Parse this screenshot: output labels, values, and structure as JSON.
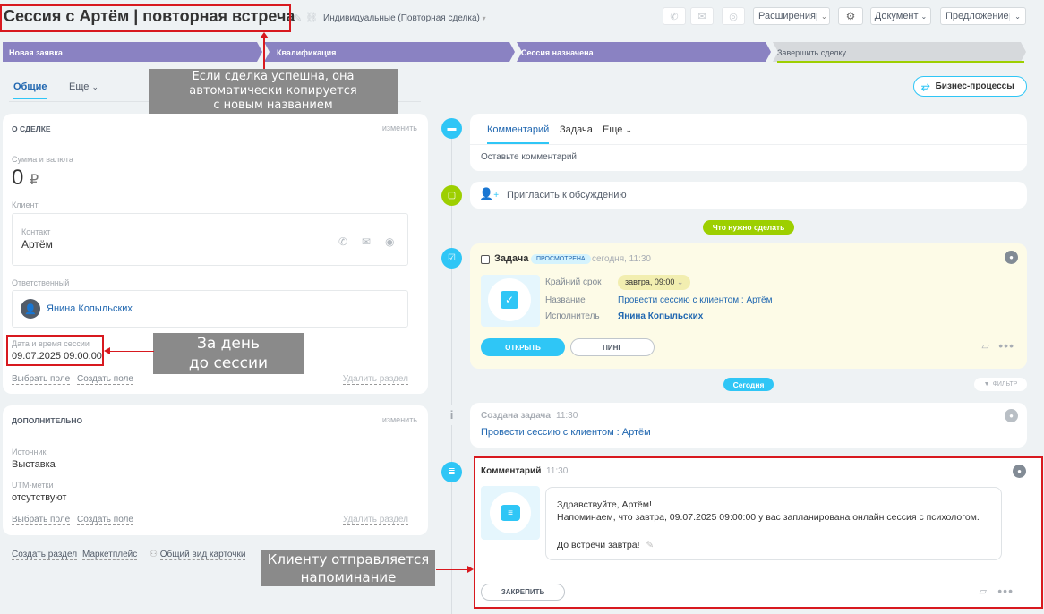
{
  "header": {
    "title": "Сессия с Артём | повторная встреча",
    "pipeline": "Индивидуальные (Повторная сделка)",
    "extensions_label": "Расширения",
    "document_label": "Документ",
    "offer_label": "Предложение"
  },
  "stages": [
    "Новая заявка",
    "Квалификация",
    "Сессия назначена",
    "Завершить сделку"
  ],
  "tabs": {
    "general": "Общие",
    "more": "Еще"
  },
  "bp_button": "Бизнес-процессы",
  "about": {
    "heading": "О СДЕЛКЕ",
    "edit": "изменить",
    "amount_label": "Сумма и валюта",
    "amount": "0",
    "currency": "₽",
    "client_label": "Клиент",
    "contact_label": "Контакт",
    "contact_name": "Артём",
    "responsible_label": "Ответственный",
    "responsible_name": "Янина Копыльских",
    "session_label": "Дата и время сессии",
    "session_value": "09.07.2025 09:00:00",
    "select_field": "Выбрать поле",
    "create_field": "Создать поле",
    "delete_section": "Удалить раздел"
  },
  "extra": {
    "heading": "ДОПОЛНИТЕЛЬНО",
    "edit": "изменить",
    "source_label": "Источник",
    "source_value": "Выставка",
    "utm_label": "UTM-метки",
    "utm_value": "отсутствуют",
    "select_field": "Выбрать поле",
    "create_field": "Создать поле",
    "delete_section": "Удалить раздел"
  },
  "bottom_links": {
    "create_section": "Создать раздел",
    "marketplace": "Маркетплейс",
    "card_view": "Общий вид карточки"
  },
  "composer": {
    "tab_comment": "Комментарий",
    "tab_task": "Задача",
    "tab_more": "Еще",
    "placeholder": "Оставьте комментарий"
  },
  "invite": "Пригласить к обсуждению",
  "todo_badge": "Что нужно сделать",
  "task": {
    "title": "Задача",
    "badge": "ПРОСМОТРЕНА",
    "time": "сегодня, 11:30",
    "deadline_label": "Крайний срок",
    "deadline_value": "завтра, 09:00",
    "name_label": "Название",
    "name_value": "Провести сессию с клиентом : Артём",
    "assignee_label": "Исполнитель",
    "assignee_value": "Янина Копыльских",
    "open": "ОТКРЫТЬ",
    "ping": "ПИНГ"
  },
  "today_badge": "Сегодня",
  "filter": "ФИЛЬТР",
  "created_task": {
    "title": "Создана задача",
    "time": "11:30",
    "link": "Провести сессию с клиентом : Артём"
  },
  "comment": {
    "title": "Комментарий",
    "time": "11:30",
    "line1": "Здравствуйте, Артём!",
    "line2": "Напоминаем, что завтра, 09.07.2025 09:00:00 у вас запланирована онлайн сессия с психологом.",
    "line3": "До встречи завтра!",
    "pin": "ЗАКРЕПИТЬ"
  },
  "annotations": {
    "a1_l1": "Если сделка успешна, она",
    "a1_l2": "автоматически копируется",
    "a1_l3": "с новым названием",
    "a2_l1": "За день",
    "a2_l2": "до сессии",
    "a3_l1": "Клиенту отправляется",
    "a3_l2": "напоминание"
  },
  "colors": {
    "accent": "#2fc6f6",
    "stage": "#8a82c2",
    "link": "#2067b0",
    "lime": "#9dcf00",
    "annotation_red": "#d8191f"
  }
}
